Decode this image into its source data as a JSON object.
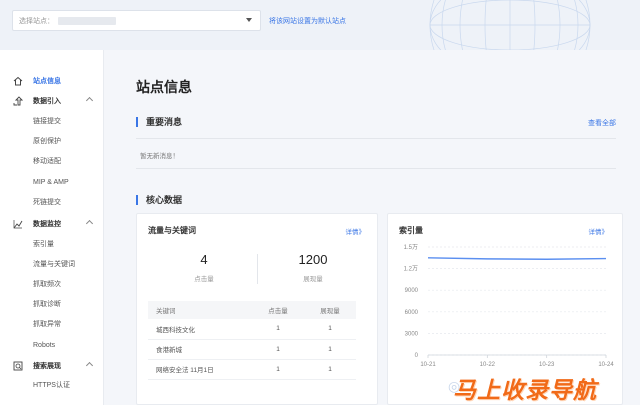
{
  "header": {
    "site_select_label": "选择站点：",
    "set_default_link": "将该网站设置为默认站点"
  },
  "sidebar": {
    "items": [
      {
        "label": "站点信息",
        "icon": "home-icon",
        "type": "group",
        "active": true
      },
      {
        "label": "数据引入",
        "icon": "import-icon",
        "type": "group"
      },
      {
        "label": "链接提交",
        "type": "sub"
      },
      {
        "label": "原创保护",
        "type": "sub"
      },
      {
        "label": "移动适配",
        "type": "sub"
      },
      {
        "label": "MIP & AMP",
        "type": "sub"
      },
      {
        "label": "死链提交",
        "type": "sub"
      },
      {
        "label": "数据监控",
        "icon": "chart-icon",
        "type": "group"
      },
      {
        "label": "索引量",
        "type": "sub"
      },
      {
        "label": "流量与关键词",
        "type": "sub"
      },
      {
        "label": "抓取频次",
        "type": "sub"
      },
      {
        "label": "抓取诊断",
        "type": "sub"
      },
      {
        "label": "抓取异常",
        "type": "sub"
      },
      {
        "label": "Robots",
        "type": "sub"
      },
      {
        "label": "搜索展现",
        "icon": "search-display-icon",
        "type": "group"
      },
      {
        "label": "HTTPS认证",
        "type": "sub"
      }
    ]
  },
  "main": {
    "title": "站点信息",
    "important_msgs": {
      "title": "重要消息",
      "view_all": "查看全部",
      "empty_text": "暂无新消息！"
    },
    "core_data": {
      "title": "核心数据"
    },
    "traffic_card": {
      "title": "流量与关键词",
      "detail_link": "详情》",
      "clicks_value": "4",
      "clicks_label": "点击量",
      "impressions_value": "1200",
      "impressions_label": "展现量",
      "table": {
        "headers": [
          "关键词",
          "点击量",
          "展现量"
        ],
        "rows": [
          [
            "城西科技文化",
            "1",
            "1"
          ],
          [
            "食港新城",
            "1",
            "1"
          ],
          [
            "网络安全法 11月1日",
            "1",
            "1"
          ]
        ]
      }
    },
    "index_card": {
      "title": "索引量",
      "detail_link": "详情》"
    }
  },
  "chart_data": {
    "type": "line",
    "title": "索引量",
    "x": [
      "10-21",
      "10-22",
      "10-23",
      "10-24"
    ],
    "series": [
      {
        "values": [
          13500,
          13350,
          13300,
          13400
        ]
      }
    ],
    "y_ticks": [
      "1.5万",
      "1.2万",
      "9000",
      "6000",
      "3000",
      "0"
    ],
    "y_tick_values": [
      15000,
      12000,
      9000,
      6000,
      3000,
      0
    ],
    "ylim": [
      0,
      15000
    ],
    "grid": true,
    "line_color": "#5b8ff0"
  },
  "watermark": "马上收录导航",
  "colors": {
    "accent": "#3a76e6",
    "watermark": "#f16a18"
  }
}
